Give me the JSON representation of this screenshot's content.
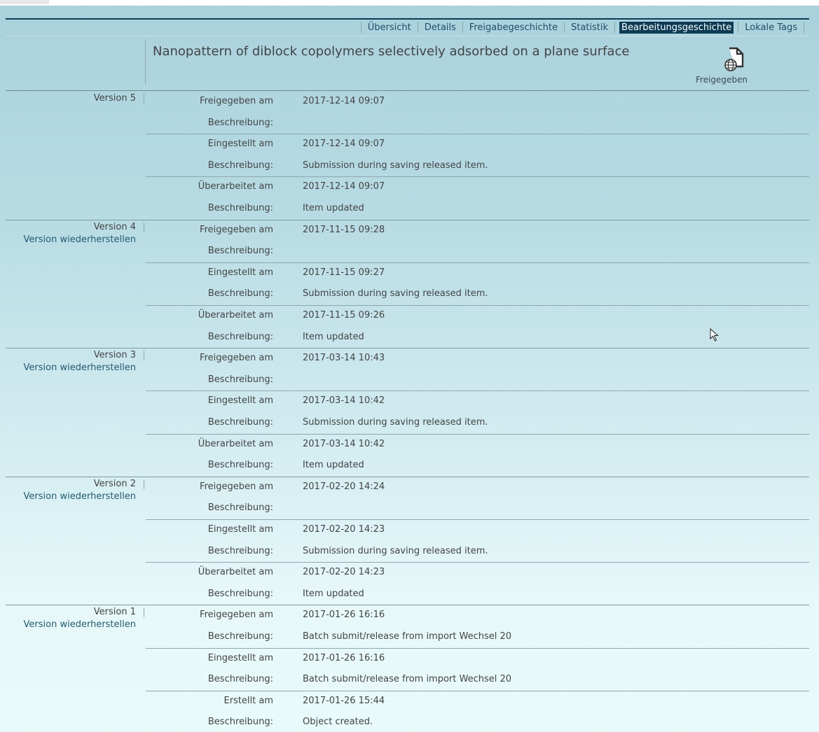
{
  "nav": {
    "tabs": [
      {
        "label": "Übersicht",
        "active": false
      },
      {
        "label": "Details",
        "active": false
      },
      {
        "label": "Freigabegeschichte",
        "active": false
      },
      {
        "label": "Statistik",
        "active": false
      },
      {
        "label": "Bearbeitungsgeschichte",
        "active": true
      },
      {
        "label": "Lokale Tags",
        "active": false
      }
    ]
  },
  "item": {
    "title": "Nanopattern of diblock copolymers selectively adsorbed on a plane surface",
    "status_label": "Freigegeben",
    "status_icon": "released-globe-document-icon"
  },
  "versions": [
    {
      "label": "Version 5",
      "restore_label": "",
      "events": [
        {
          "label": "Freigegeben am",
          "date": "2017-12-14 09:07",
          "desc_label": "Beschreibung:",
          "desc": ""
        },
        {
          "label": "Eingestellt am",
          "date": "2017-12-14 09:07",
          "desc_label": "Beschreibung:",
          "desc": "Submission during saving released item."
        },
        {
          "label": "Überarbeitet am",
          "date": "2017-12-14 09:07",
          "desc_label": "Beschreibung:",
          "desc": "Item updated"
        }
      ]
    },
    {
      "label": "Version 4",
      "restore_label": "Version wiederherstellen",
      "events": [
        {
          "label": "Freigegeben am",
          "date": "2017-11-15 09:28",
          "desc_label": "Beschreibung:",
          "desc": ""
        },
        {
          "label": "Eingestellt am",
          "date": "2017-11-15 09:27",
          "desc_label": "Beschreibung:",
          "desc": "Submission during saving released item."
        },
        {
          "label": "Überarbeitet am",
          "date": "2017-11-15 09:26",
          "desc_label": "Beschreibung:",
          "desc": "Item updated"
        }
      ]
    },
    {
      "label": "Version 3",
      "restore_label": "Version wiederherstellen",
      "events": [
        {
          "label": "Freigegeben am",
          "date": "2017-03-14 10:43",
          "desc_label": "Beschreibung:",
          "desc": ""
        },
        {
          "label": "Eingestellt am",
          "date": "2017-03-14 10:42",
          "desc_label": "Beschreibung:",
          "desc": "Submission during saving released item."
        },
        {
          "label": "Überarbeitet am",
          "date": "2017-03-14 10:42",
          "desc_label": "Beschreibung:",
          "desc": "Item updated"
        }
      ]
    },
    {
      "label": "Version 2",
      "restore_label": "Version wiederherstellen",
      "events": [
        {
          "label": "Freigegeben am",
          "date": "2017-02-20 14:24",
          "desc_label": "Beschreibung:",
          "desc": ""
        },
        {
          "label": "Eingestellt am",
          "date": "2017-02-20 14:23",
          "desc_label": "Beschreibung:",
          "desc": "Submission during saving released item."
        },
        {
          "label": "Überarbeitet am",
          "date": "2017-02-20 14:23",
          "desc_label": "Beschreibung:",
          "desc": "Item updated"
        }
      ]
    },
    {
      "label": "Version 1",
      "restore_label": "Version wiederherstellen",
      "events": [
        {
          "label": "Freigegeben am",
          "date": "2017-01-26 16:16",
          "desc_label": "Beschreibung:",
          "desc": "Batch submit/release from import Wechsel 20"
        },
        {
          "label": "Eingestellt am",
          "date": "2017-01-26 16:16",
          "desc_label": "Beschreibung:",
          "desc": "Batch submit/release from import Wechsel 20"
        },
        {
          "label": "Erstellt am",
          "date": "2017-01-26 15:44",
          "desc_label": "Beschreibung:",
          "desc": "Object created."
        }
      ]
    }
  ],
  "colors": {
    "accent": "#0b3b55",
    "link": "#1f5a73",
    "text": "#444444"
  }
}
